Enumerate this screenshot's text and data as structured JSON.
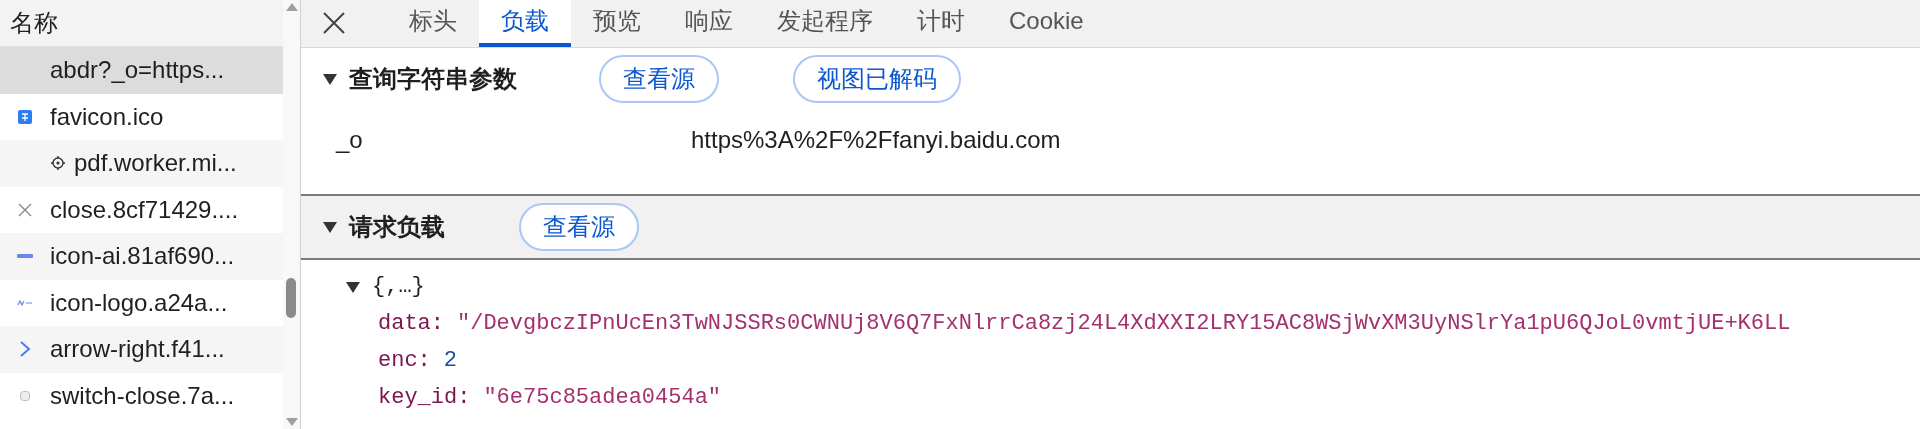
{
  "sidebar": {
    "header": "名称",
    "requests": [
      {
        "name": "abdr?_o=https...",
        "selected": true
      },
      {
        "name": "favicon.ico",
        "selected": false
      },
      {
        "name": "pdf.worker.mi...",
        "selected": false
      },
      {
        "name": "close.8cf71429....",
        "selected": false
      },
      {
        "name": "icon-ai.81af690...",
        "selected": false
      },
      {
        "name": "icon-logo.a24a...",
        "selected": false
      },
      {
        "name": "arrow-right.f41...",
        "selected": false
      },
      {
        "name": "switch-close.7a...",
        "selected": false
      }
    ]
  },
  "tabs": [
    {
      "label": "标头",
      "selected": false
    },
    {
      "label": "负载",
      "selected": true
    },
    {
      "label": "预览",
      "selected": false
    },
    {
      "label": "响应",
      "selected": false
    },
    {
      "label": "发起程序",
      "selected": false
    },
    {
      "label": "计时",
      "selected": false
    },
    {
      "label": "Cookie",
      "selected": false
    }
  ],
  "query_params": {
    "title": "查询字符串参数",
    "expanded": true,
    "buttons": [
      "查看源",
      "视图已解码"
    ],
    "params": [
      {
        "name": "_o",
        "value": "https%3A%2F%2Ffanyi.baidu.com"
      }
    ]
  },
  "request_payload": {
    "title": "请求负载",
    "expanded": true,
    "buttons": [
      "查看源"
    ],
    "tree": {
      "summary": "{,…}",
      "expanded": true,
      "fields": [
        {
          "key": "data:",
          "value": "\"/DevgbczIPnUcEn3TwNJSSRs0CWNUj8V6Q7FxNlrrCa8zj24L4XdXXI2LRY15AC8WSjWvXM3UyNSlrYa1pU6QJoL0vmtjUE+K6LL",
          "kind": "string"
        },
        {
          "key": "enc:",
          "value": "2",
          "kind": "number"
        },
        {
          "key": "key_id:",
          "value": "\"6e75c85adea0454a\"",
          "kind": "string"
        }
      ]
    }
  }
}
